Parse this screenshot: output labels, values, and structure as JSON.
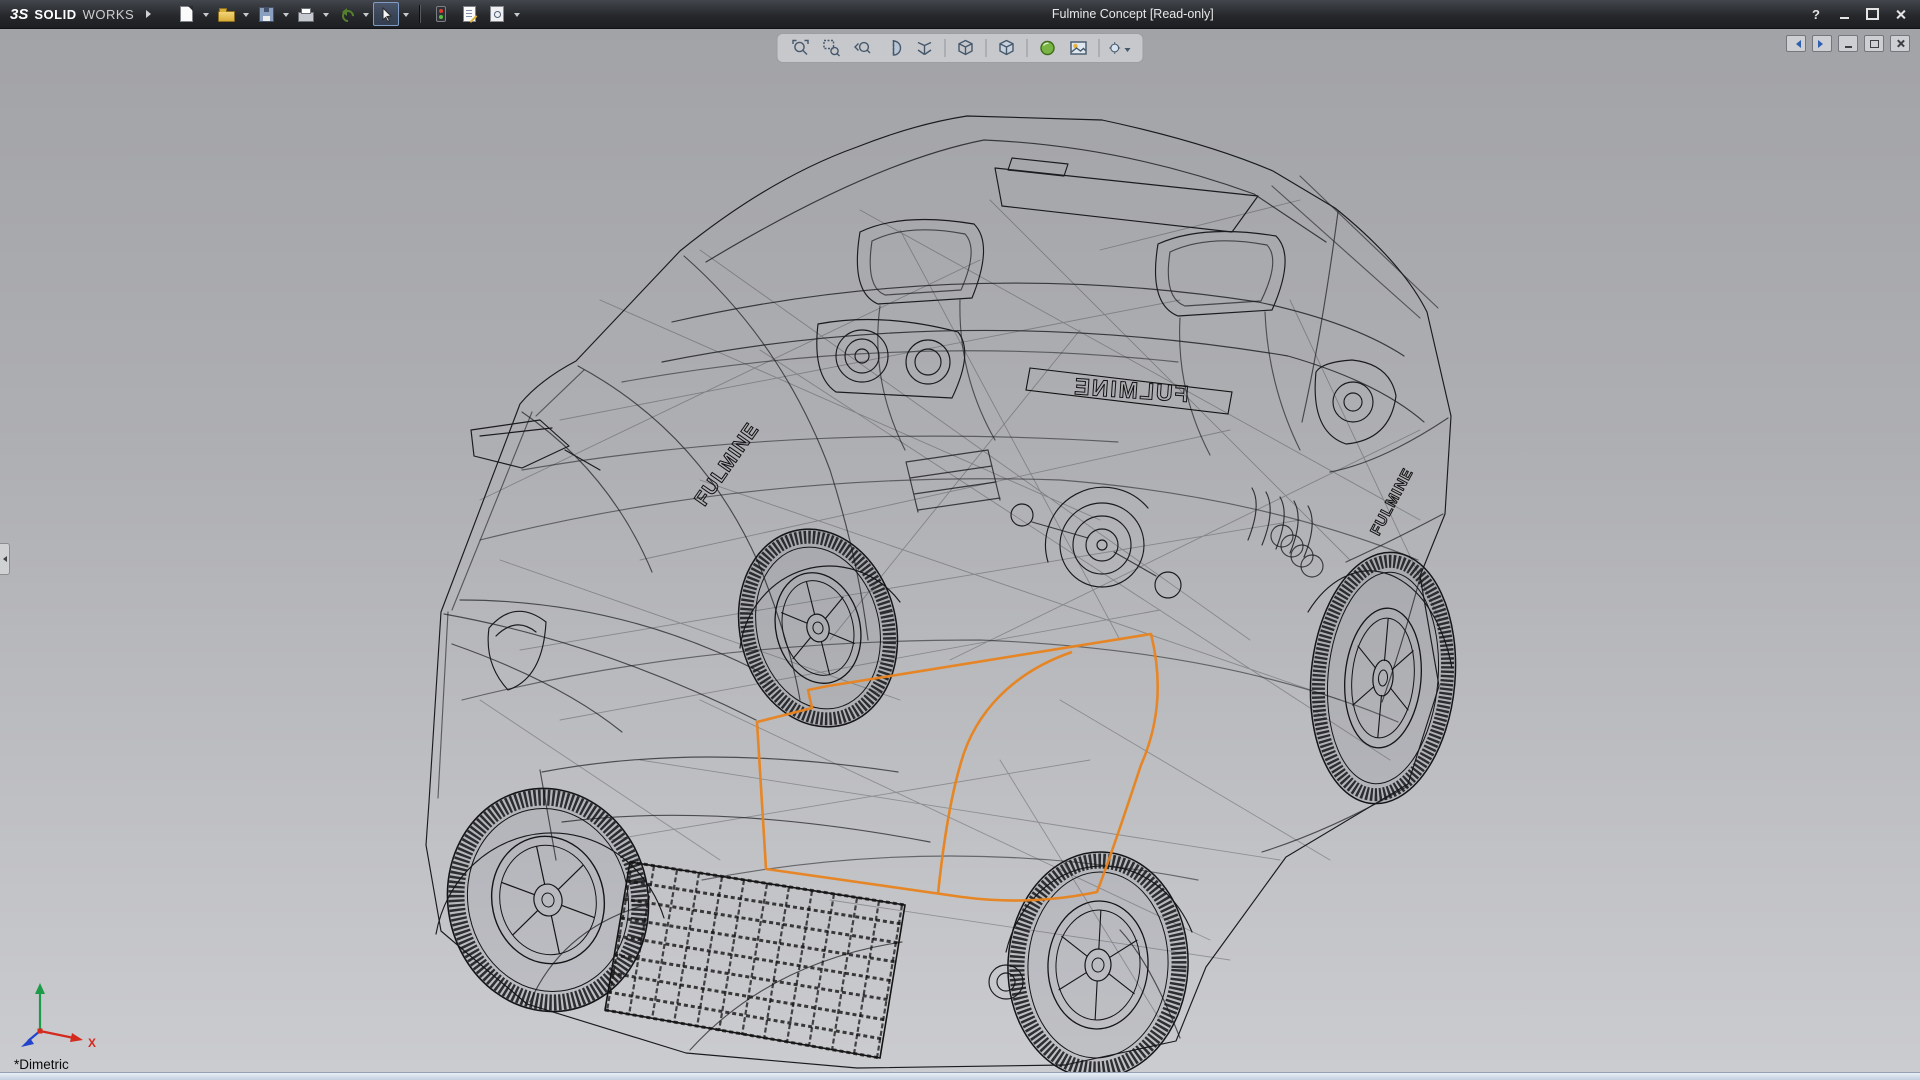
{
  "window": {
    "brand": {
      "mark": "3S",
      "solid": "SOLID",
      "works": "WORKS"
    },
    "title": "Fulmine Concept [Read-only]",
    "controls": {
      "help": "?"
    },
    "control_icons": [
      "help-icon",
      "minimize-icon",
      "maximize-icon",
      "close-icon"
    ]
  },
  "main_toolbar": {
    "icons": [
      "new-document-icon",
      "open-folder-icon",
      "save-icon",
      "print-icon",
      "undo-icon",
      "select-cursor-icon",
      "rebuild-icon",
      "file-properties-icon",
      "options-icon"
    ],
    "active_tool": "select"
  },
  "heads_up_toolbar": {
    "icons": [
      "zoom-to-fit-icon",
      "zoom-to-area-icon",
      "previous-view-icon",
      "section-view-icon",
      "view-selector-icon",
      "view-orientation-icon",
      "display-style-icon",
      "edit-appearance-icon",
      "apply-scene-icon",
      "view-settings-icon"
    ]
  },
  "document_controls": {
    "icons": [
      "doc-previous-icon",
      "doc-next-icon",
      "doc-minimize-icon",
      "doc-restore-icon",
      "doc-close-icon"
    ]
  },
  "viewport": {
    "orientation_label": "*Dimetric",
    "model_badge": "FULMINE",
    "sketch_color": "#e8831d",
    "wireframe_color": "#1a1b1d",
    "triad": {
      "x_label": "X"
    }
  },
  "colors": {
    "titlebar_bg": "#2b2e33",
    "viewport_top": "#a2a3a7",
    "viewport_bottom": "#cbccd0",
    "statusbar_bg": "#d7e0ec",
    "highlight_orange": "#e8831d"
  }
}
